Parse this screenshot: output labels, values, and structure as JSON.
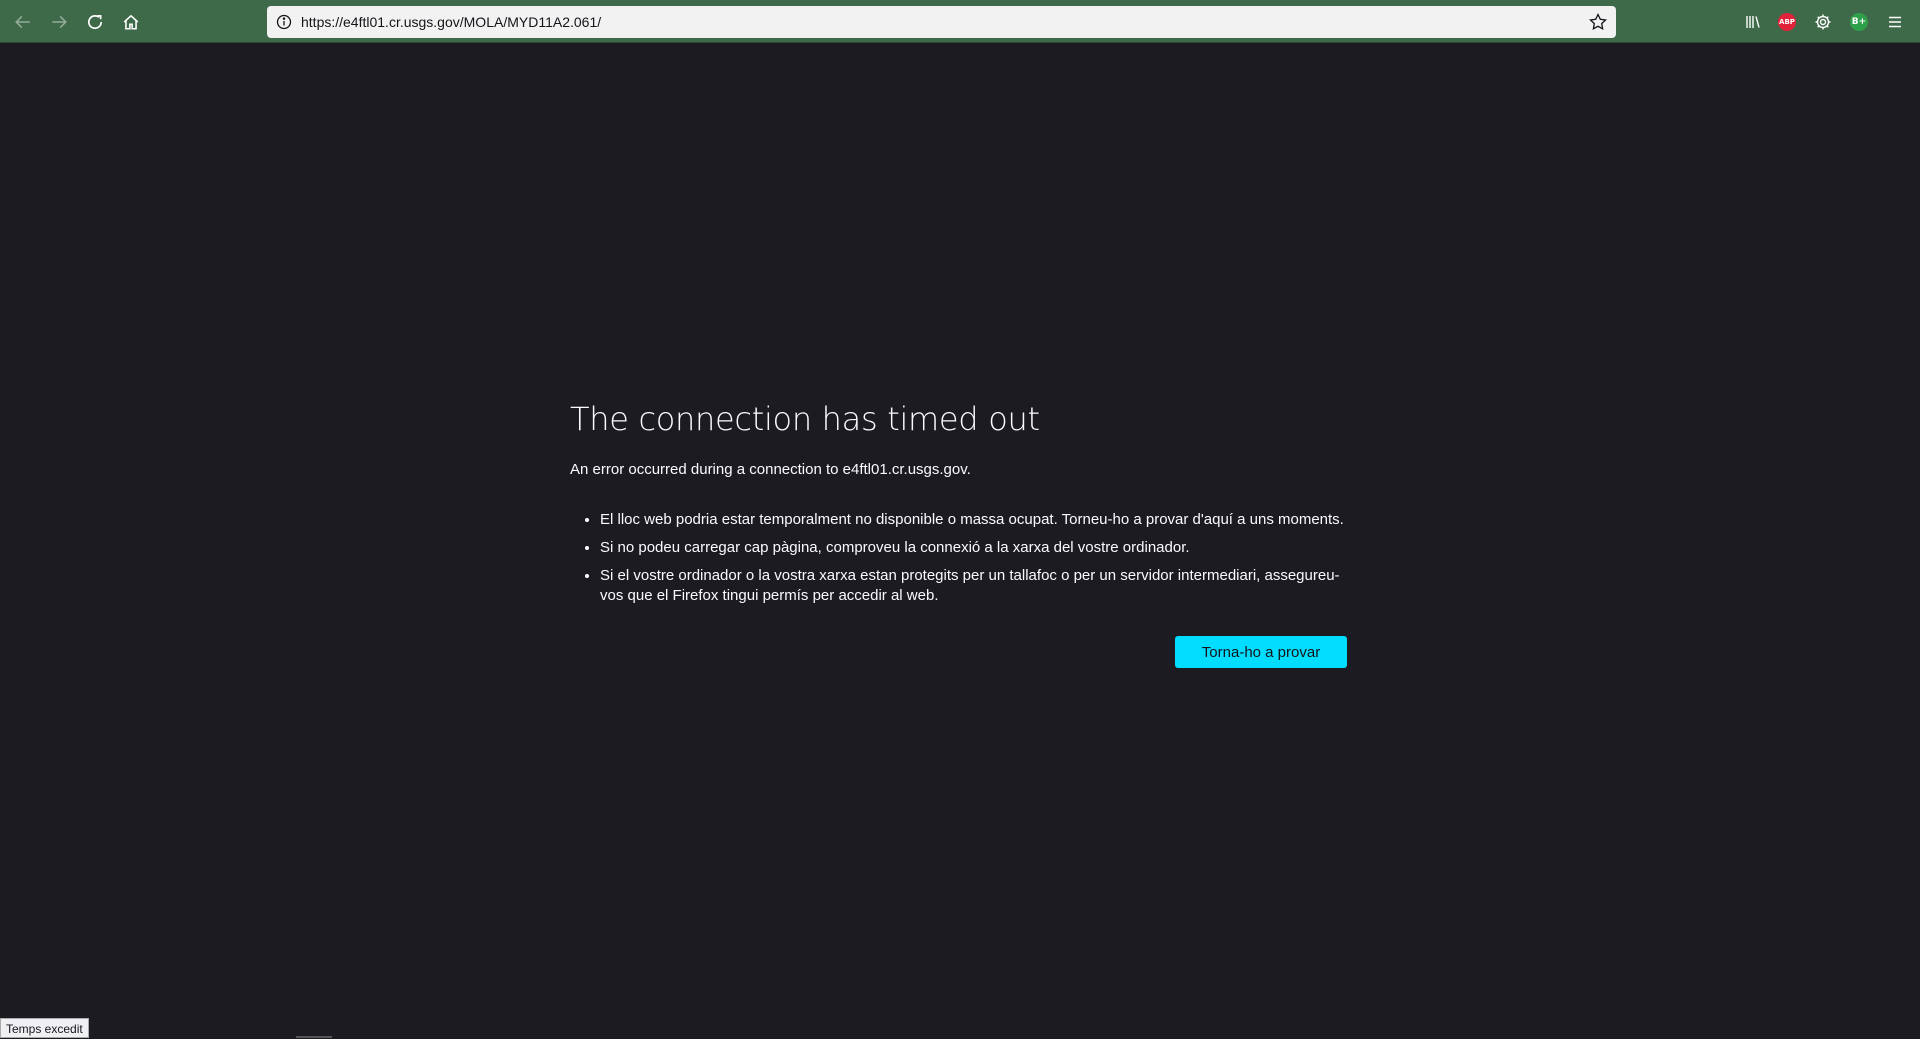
{
  "browser": {
    "url": "https://e4ftl01.cr.usgs.gov/MOLA/MYD11A2.061/",
    "toolbar_color": "#3e6a4a",
    "nav_icons": [
      "back-icon",
      "forward-icon",
      "reload-icon",
      "home-icon"
    ],
    "right_icons": [
      "library-icon",
      "adblock-plus-icon",
      "settings-icon",
      "extension-icon",
      "menu-icon"
    ],
    "abp_label": "ABP",
    "extension_label": "B+"
  },
  "error_page": {
    "title": "The connection has timed out",
    "description": "An error occurred during a connection to e4ftl01.cr.usgs.gov.",
    "bullets": [
      "El lloc web podria estar temporalment no disponible o massa ocupat. Torneu-ho a provar d'aquí a uns moments.",
      "Si no podeu carregar cap pàgina, comproveu la connexió a la xarxa del vostre ordinador.",
      "Si el vostre ordinador o la vostra xarxa estan protegits per un tallafoc o per un servidor intermediari, assegureu-vos que el Firefox tingui permís per accedir al web."
    ],
    "retry_label": "Torna-ho a provar",
    "button_color": "#00ddff"
  },
  "status": {
    "text": "Temps excedit"
  }
}
